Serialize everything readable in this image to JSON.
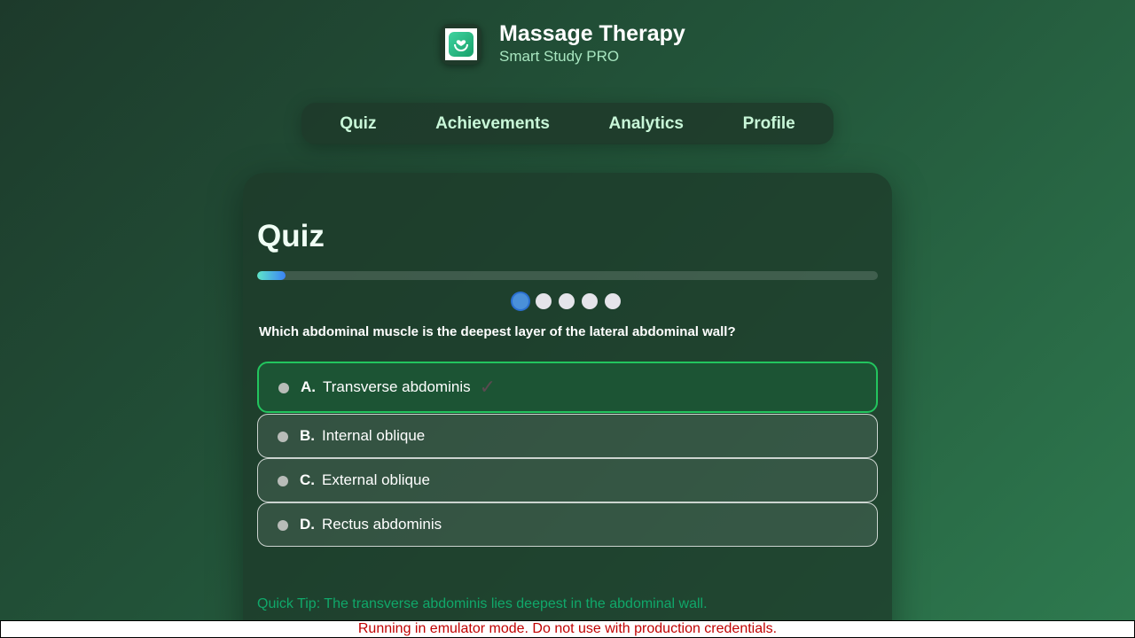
{
  "header": {
    "icon": "massage-hands-icon",
    "title": "Massage Therapy",
    "subtitle": "Smart Study PRO"
  },
  "nav": {
    "items": [
      {
        "label": "Quiz"
      },
      {
        "label": "Achievements"
      },
      {
        "label": "Analytics"
      },
      {
        "label": "Profile"
      }
    ]
  },
  "quiz": {
    "title": "Quiz",
    "progress": 0.045,
    "total_questions": 5,
    "current_question": 1,
    "question": "Which abdominal muscle is the deepest layer of the lateral abdominal wall?",
    "options": [
      {
        "letter": "A.",
        "text": "Transverse abdominis",
        "selected": true,
        "correct_mark": "check-icon"
      },
      {
        "letter": "B.",
        "text": "Internal oblique",
        "selected": false
      },
      {
        "letter": "C.",
        "text": "External oblique",
        "selected": false
      },
      {
        "letter": "D.",
        "text": "Rectus abdominis",
        "selected": false
      }
    ],
    "tip": "Quick Tip: The transverse abdominis lies deepest in the abdominal wall."
  },
  "banner": {
    "text": "Running in emulator mode. Do not use with production credentials."
  },
  "colors": {
    "accent_green": "#22c55e",
    "progress_start": "#5ee6c8",
    "progress_end": "#3b82f6",
    "banner_text": "#c00000"
  }
}
